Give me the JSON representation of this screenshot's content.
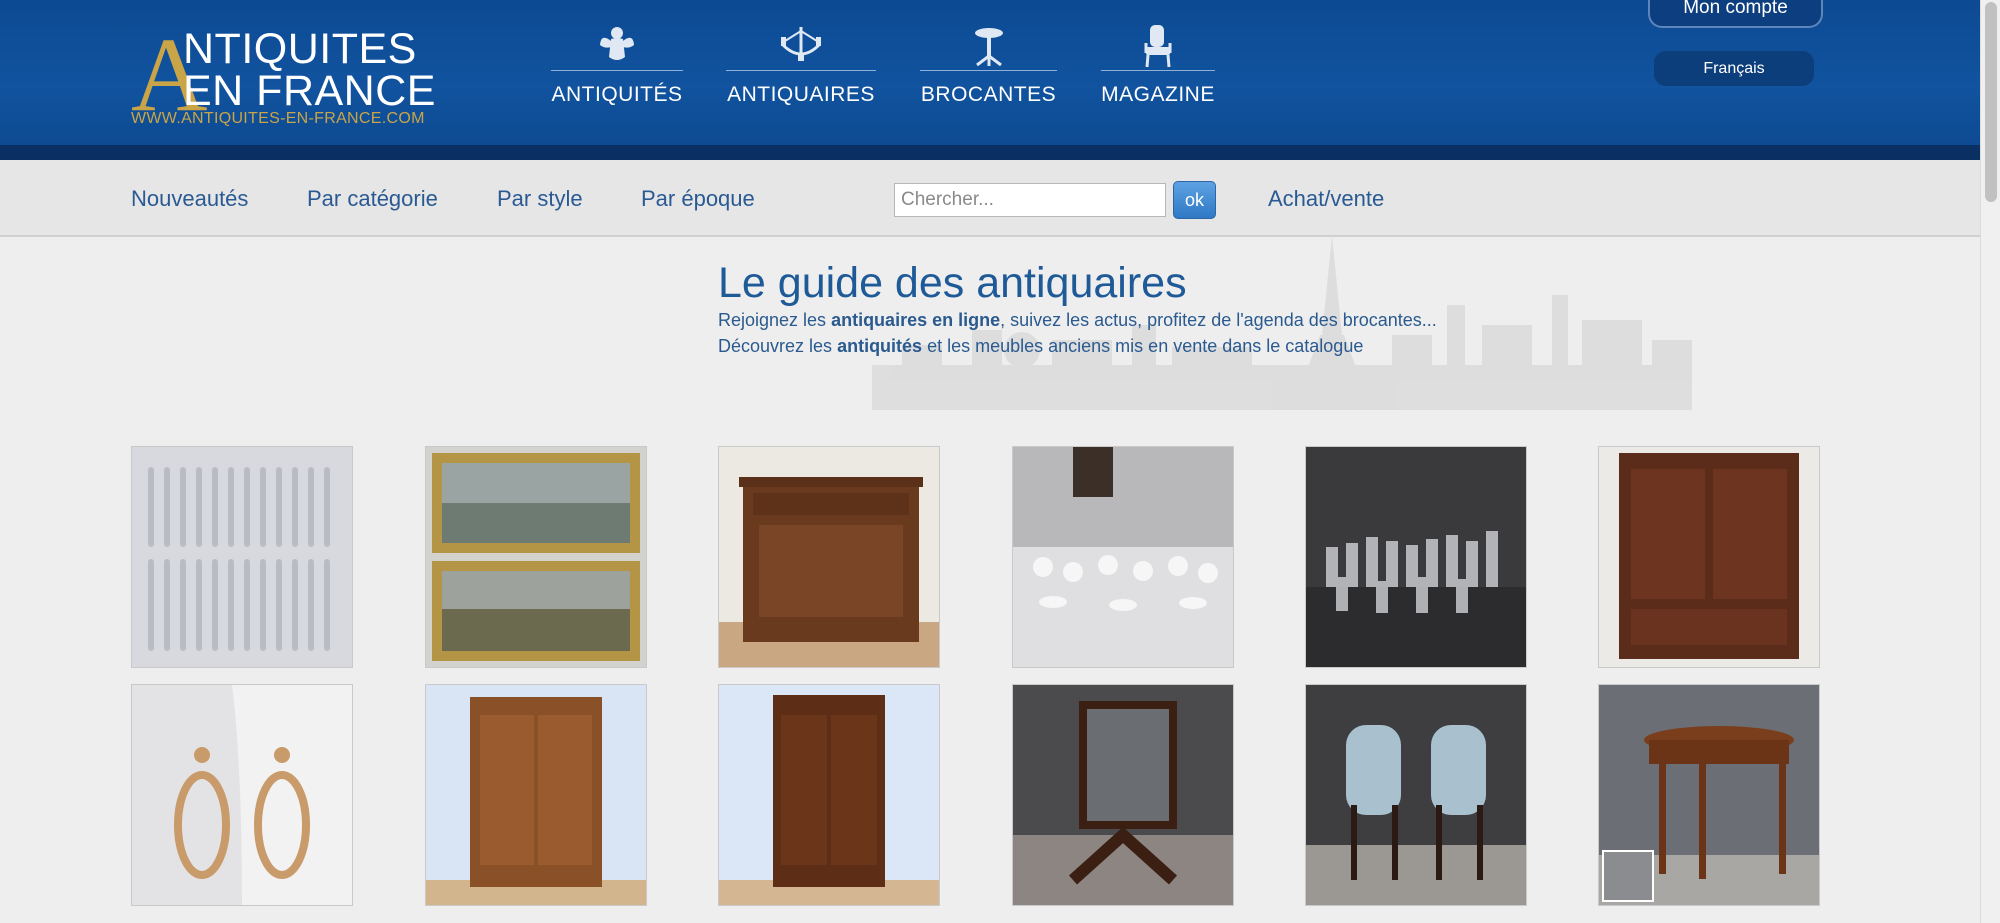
{
  "header": {
    "logo": {
      "big_letter": "A",
      "line1": "NTIQUITES",
      "line2": "EN FRANCE",
      "url": "WWW.ANTIQUITES-EN-FRANCE.COM"
    },
    "nav": [
      {
        "label": "ANTIQUITÉS",
        "icon": "cherub-icon"
      },
      {
        "label": "ANTIQUAIRES",
        "icon": "chandelier-icon"
      },
      {
        "label": "BROCANTES",
        "icon": "pedestal-table-icon"
      },
      {
        "label": "MAGAZINE",
        "icon": "armchair-icon"
      }
    ],
    "account_label": "Mon compte",
    "language_label": "Français"
  },
  "subnav": {
    "links": [
      "Nouveautés",
      "Par catégorie",
      "Par style",
      "Par époque"
    ],
    "search_placeholder": "Chercher...",
    "search_button": "ok",
    "buy_sell": "Achat/vente"
  },
  "hero": {
    "title": "Le guide des antiquaires",
    "line1_pre": "Rejoignez les ",
    "line1_bold": "antiquaires en ligne",
    "line1_post": ", suivez les actus, profitez de l'agenda des brocantes...",
    "line2_pre": "Découvrez les ",
    "line2_bold": "antiquités",
    "line2_post": " et les meubles anciens mis en vente dans le catalogue"
  },
  "colors": {
    "header_blue": "#11539f",
    "gold": "#c9a547",
    "link_blue": "#2a5a93"
  }
}
